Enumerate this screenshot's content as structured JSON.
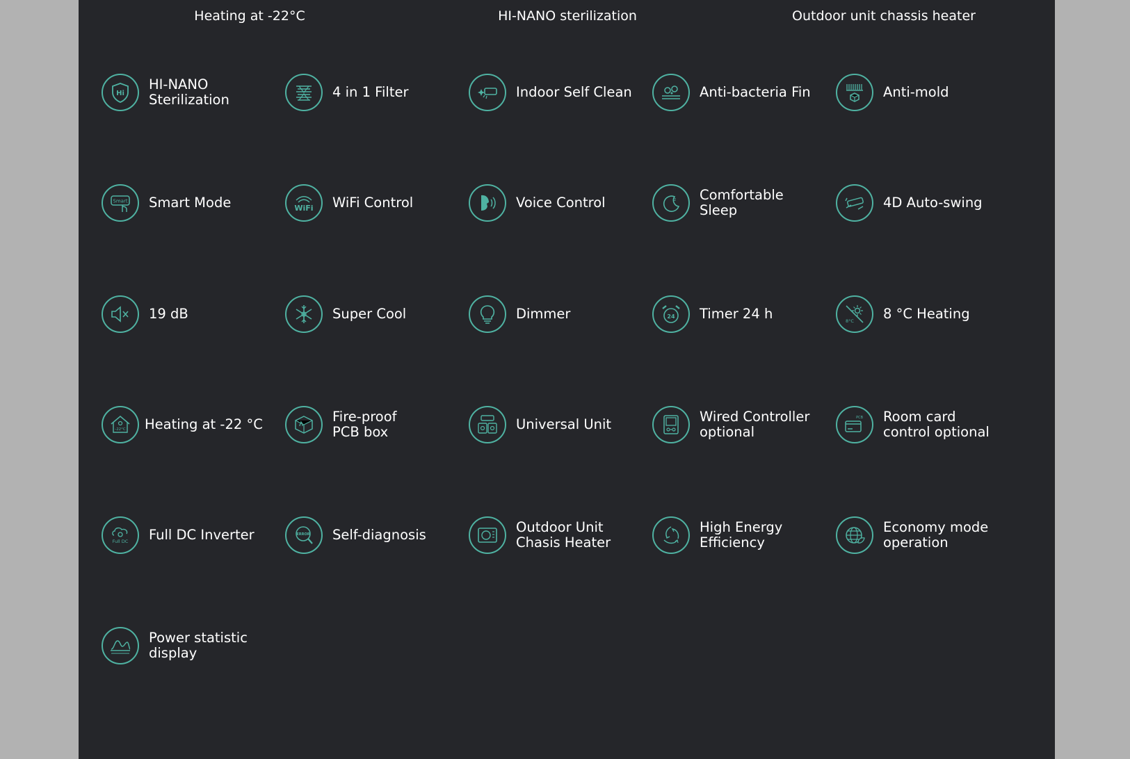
{
  "headings": [
    "Heating at -22°C",
    "HI-NANO sterilization",
    "Outdoor unit chassis heater"
  ],
  "accent_color": "#4fb2a2",
  "background_color": "#25262a",
  "features": [
    {
      "icon": "hi-nano-shield-icon",
      "label": "HI-NANO\nSterilization"
    },
    {
      "icon": "filter-icon",
      "label": "4 in 1 Filter"
    },
    {
      "icon": "self-clean-icon",
      "label": "Indoor Self Clean"
    },
    {
      "icon": "anti-bacteria-fin-icon",
      "label": "Anti-bacteria Fin"
    },
    {
      "icon": "anti-mold-icon",
      "label": "Anti-mold"
    },
    {
      "icon": "smart-mode-icon",
      "label": "Smart Mode",
      "icon_text": "Smart"
    },
    {
      "icon": "wifi-icon",
      "label": "WiFi Control",
      "icon_text": "WiFi"
    },
    {
      "icon": "voice-control-icon",
      "label": "Voice Control"
    },
    {
      "icon": "sleep-moon-icon",
      "label": "Comfortable\nSleep"
    },
    {
      "icon": "auto-swing-icon",
      "label": "4D Auto-swing"
    },
    {
      "icon": "mute-speaker-icon",
      "label": "19 dB"
    },
    {
      "icon": "snowflake-icon",
      "label": "Super Cool"
    },
    {
      "icon": "light-bulb-icon",
      "label": "Dimmer"
    },
    {
      "icon": "alarm-clock-icon",
      "label": "Timer 24 h",
      "icon_text": "24"
    },
    {
      "icon": "sun-heating-icon",
      "label": "8 °C Heating",
      "icon_text": "8°C"
    },
    {
      "icon": "house-heating-icon",
      "label": "Heating at -22 °C",
      "icon_text": "-22°C"
    },
    {
      "icon": "fireproof-box-icon",
      "label": "Fire-proof\nPCB box"
    },
    {
      "icon": "universal-unit-icon",
      "label": "Universal Unit"
    },
    {
      "icon": "wired-controller-icon",
      "label": "Wired Controller\noptional"
    },
    {
      "icon": "room-card-icon",
      "label": "Room card\ncontrol optional",
      "icon_text": "PCB"
    },
    {
      "icon": "dc-inverter-icon",
      "label": "Full DC Inverter",
      "icon_text": "Full DC"
    },
    {
      "icon": "error-diagnosis-icon",
      "label": "Self-diagnosis",
      "icon_text": "ERROR"
    },
    {
      "icon": "outdoor-unit-icon",
      "label": "Outdoor Unit\nChasis Heater"
    },
    {
      "icon": "energy-efficiency-icon",
      "label": "High Energy\nEfficiency"
    },
    {
      "icon": "globe-leaf-icon",
      "label": "Economy mode\noperation"
    },
    {
      "icon": "power-graph-icon",
      "label": "Power statistic\ndisplay"
    }
  ]
}
